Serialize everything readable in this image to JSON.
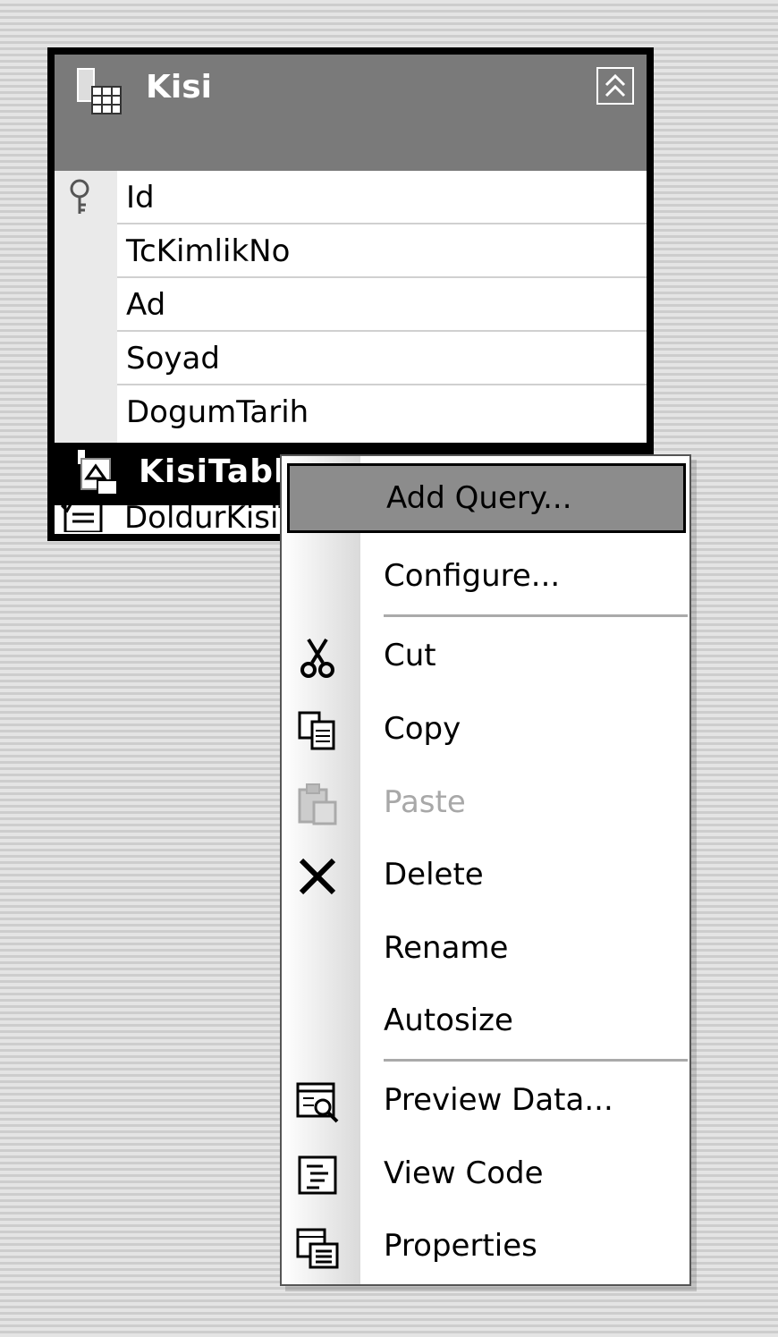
{
  "table": {
    "title": "Kisi",
    "columns": [
      "Id",
      "TcKimlikNo",
      "Ad",
      "Soyad",
      "DogumTarih"
    ]
  },
  "adapter": {
    "title": "KisiTableAdapter",
    "method": "DoldurKisiT"
  },
  "context_menu": {
    "items": [
      {
        "label": "Add Query...",
        "icon": "none",
        "enabled": true
      },
      {
        "label": "Configure...",
        "icon": "none",
        "enabled": true
      },
      {
        "label": "Cut",
        "icon": "scissors-icon",
        "enabled": true
      },
      {
        "label": "Copy",
        "icon": "copy-icon",
        "enabled": true
      },
      {
        "label": "Paste",
        "icon": "paste-icon",
        "enabled": false
      },
      {
        "label": "Delete",
        "icon": "delete-icon",
        "enabled": true
      },
      {
        "label": "Rename",
        "icon": "none",
        "enabled": true
      },
      {
        "label": "Autosize",
        "icon": "none",
        "enabled": true
      },
      {
        "label": "Preview Data...",
        "icon": "preview-data-icon",
        "enabled": true
      },
      {
        "label": "View Code",
        "icon": "view-code-icon",
        "enabled": true
      },
      {
        "label": "Properties",
        "icon": "properties-icon",
        "enabled": true
      }
    ]
  }
}
